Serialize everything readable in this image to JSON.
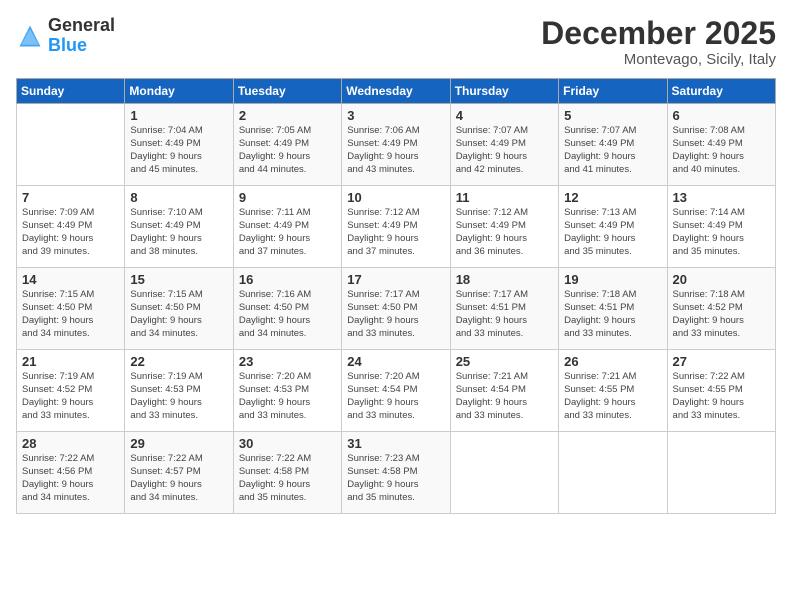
{
  "header": {
    "logo_general": "General",
    "logo_blue": "Blue",
    "month": "December 2025",
    "location": "Montevago, Sicily, Italy"
  },
  "weekdays": [
    "Sunday",
    "Monday",
    "Tuesday",
    "Wednesday",
    "Thursday",
    "Friday",
    "Saturday"
  ],
  "weeks": [
    [
      {
        "day": "",
        "info": ""
      },
      {
        "day": "1",
        "info": "Sunrise: 7:04 AM\nSunset: 4:49 PM\nDaylight: 9 hours\nand 45 minutes."
      },
      {
        "day": "2",
        "info": "Sunrise: 7:05 AM\nSunset: 4:49 PM\nDaylight: 9 hours\nand 44 minutes."
      },
      {
        "day": "3",
        "info": "Sunrise: 7:06 AM\nSunset: 4:49 PM\nDaylight: 9 hours\nand 43 minutes."
      },
      {
        "day": "4",
        "info": "Sunrise: 7:07 AM\nSunset: 4:49 PM\nDaylight: 9 hours\nand 42 minutes."
      },
      {
        "day": "5",
        "info": "Sunrise: 7:07 AM\nSunset: 4:49 PM\nDaylight: 9 hours\nand 41 minutes."
      },
      {
        "day": "6",
        "info": "Sunrise: 7:08 AM\nSunset: 4:49 PM\nDaylight: 9 hours\nand 40 minutes."
      }
    ],
    [
      {
        "day": "7",
        "info": "Sunrise: 7:09 AM\nSunset: 4:49 PM\nDaylight: 9 hours\nand 39 minutes."
      },
      {
        "day": "8",
        "info": "Sunrise: 7:10 AM\nSunset: 4:49 PM\nDaylight: 9 hours\nand 38 minutes."
      },
      {
        "day": "9",
        "info": "Sunrise: 7:11 AM\nSunset: 4:49 PM\nDaylight: 9 hours\nand 37 minutes."
      },
      {
        "day": "10",
        "info": "Sunrise: 7:12 AM\nSunset: 4:49 PM\nDaylight: 9 hours\nand 37 minutes."
      },
      {
        "day": "11",
        "info": "Sunrise: 7:12 AM\nSunset: 4:49 PM\nDaylight: 9 hours\nand 36 minutes."
      },
      {
        "day": "12",
        "info": "Sunrise: 7:13 AM\nSunset: 4:49 PM\nDaylight: 9 hours\nand 35 minutes."
      },
      {
        "day": "13",
        "info": "Sunrise: 7:14 AM\nSunset: 4:49 PM\nDaylight: 9 hours\nand 35 minutes."
      }
    ],
    [
      {
        "day": "14",
        "info": "Sunrise: 7:15 AM\nSunset: 4:50 PM\nDaylight: 9 hours\nand 34 minutes."
      },
      {
        "day": "15",
        "info": "Sunrise: 7:15 AM\nSunset: 4:50 PM\nDaylight: 9 hours\nand 34 minutes."
      },
      {
        "day": "16",
        "info": "Sunrise: 7:16 AM\nSunset: 4:50 PM\nDaylight: 9 hours\nand 34 minutes."
      },
      {
        "day": "17",
        "info": "Sunrise: 7:17 AM\nSunset: 4:50 PM\nDaylight: 9 hours\nand 33 minutes."
      },
      {
        "day": "18",
        "info": "Sunrise: 7:17 AM\nSunset: 4:51 PM\nDaylight: 9 hours\nand 33 minutes."
      },
      {
        "day": "19",
        "info": "Sunrise: 7:18 AM\nSunset: 4:51 PM\nDaylight: 9 hours\nand 33 minutes."
      },
      {
        "day": "20",
        "info": "Sunrise: 7:18 AM\nSunset: 4:52 PM\nDaylight: 9 hours\nand 33 minutes."
      }
    ],
    [
      {
        "day": "21",
        "info": "Sunrise: 7:19 AM\nSunset: 4:52 PM\nDaylight: 9 hours\nand 33 minutes."
      },
      {
        "day": "22",
        "info": "Sunrise: 7:19 AM\nSunset: 4:53 PM\nDaylight: 9 hours\nand 33 minutes."
      },
      {
        "day": "23",
        "info": "Sunrise: 7:20 AM\nSunset: 4:53 PM\nDaylight: 9 hours\nand 33 minutes."
      },
      {
        "day": "24",
        "info": "Sunrise: 7:20 AM\nSunset: 4:54 PM\nDaylight: 9 hours\nand 33 minutes."
      },
      {
        "day": "25",
        "info": "Sunrise: 7:21 AM\nSunset: 4:54 PM\nDaylight: 9 hours\nand 33 minutes."
      },
      {
        "day": "26",
        "info": "Sunrise: 7:21 AM\nSunset: 4:55 PM\nDaylight: 9 hours\nand 33 minutes."
      },
      {
        "day": "27",
        "info": "Sunrise: 7:22 AM\nSunset: 4:55 PM\nDaylight: 9 hours\nand 33 minutes."
      }
    ],
    [
      {
        "day": "28",
        "info": "Sunrise: 7:22 AM\nSunset: 4:56 PM\nDaylight: 9 hours\nand 34 minutes."
      },
      {
        "day": "29",
        "info": "Sunrise: 7:22 AM\nSunset: 4:57 PM\nDaylight: 9 hours\nand 34 minutes."
      },
      {
        "day": "30",
        "info": "Sunrise: 7:22 AM\nSunset: 4:58 PM\nDaylight: 9 hours\nand 35 minutes."
      },
      {
        "day": "31",
        "info": "Sunrise: 7:23 AM\nSunset: 4:58 PM\nDaylight: 9 hours\nand 35 minutes."
      },
      {
        "day": "",
        "info": ""
      },
      {
        "day": "",
        "info": ""
      },
      {
        "day": "",
        "info": ""
      }
    ]
  ]
}
